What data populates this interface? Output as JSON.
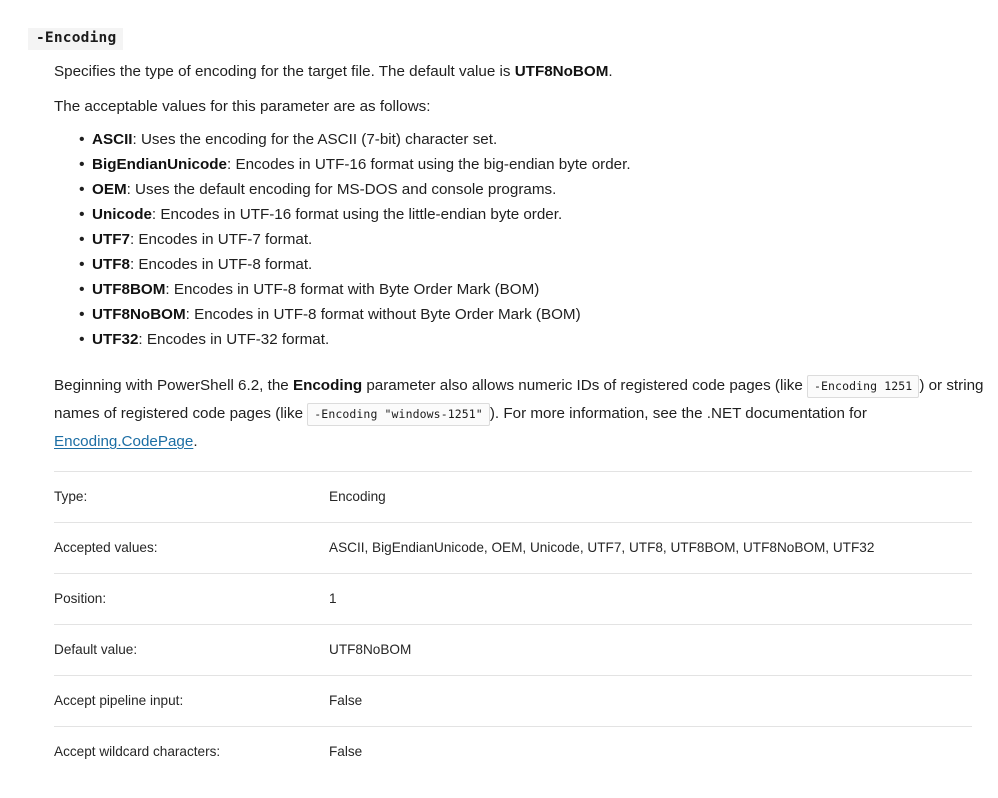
{
  "heading": {
    "text": "-Encoding"
  },
  "intro": {
    "before": "Specifies the type of encoding for the target file. The default value is ",
    "bold": "UTF8NoBOM",
    "after": "."
  },
  "acceptable_intro": "The acceptable values for this parameter are as follows:",
  "values": [
    {
      "name": "ASCII",
      "desc": ": Uses the encoding for the ASCII (7-bit) character set."
    },
    {
      "name": "BigEndianUnicode",
      "desc": ": Encodes in UTF-16 format using the big-endian byte order."
    },
    {
      "name": "OEM",
      "desc": ": Uses the default encoding for MS-DOS and console programs."
    },
    {
      "name": "Unicode",
      "desc": ": Encodes in UTF-16 format using the little-endian byte order."
    },
    {
      "name": "UTF7",
      "desc": ": Encodes in UTF-7 format."
    },
    {
      "name": "UTF8",
      "desc": ": Encodes in UTF-8 format."
    },
    {
      "name": "UTF8BOM",
      "desc": ": Encodes in UTF-8 format with Byte Order Mark (BOM)"
    },
    {
      "name": "UTF8NoBOM",
      "desc": ": Encodes in UTF-8 format without Byte Order Mark (BOM)"
    },
    {
      "name": "UTF32",
      "desc": ": Encodes in UTF-32 format."
    }
  ],
  "note": {
    "seg1": "Beginning with PowerShell 6.2, the ",
    "bold1": "Encoding",
    "seg2": " parameter also allows numeric IDs of registered code pages (like ",
    "code1": "-Encoding 1251",
    "seg3": ") or string names of registered code pages (like ",
    "code2": "-Encoding \"windows-1251\"",
    "seg4": "). For more information, see the .NET documentation for ",
    "link": "Encoding.CodePage",
    "seg5": "."
  },
  "details": {
    "rows": [
      {
        "label": "Type:",
        "value": "Encoding"
      },
      {
        "label": "Accepted values:",
        "value": "ASCII, BigEndianUnicode, OEM, Unicode, UTF7, UTF8, UTF8BOM, UTF8NoBOM, UTF32"
      },
      {
        "label": "Position:",
        "value": "1"
      },
      {
        "label": "Default value:",
        "value": "UTF8NoBOM"
      },
      {
        "label": "Accept pipeline input:",
        "value": "False"
      },
      {
        "label": "Accept wildcard characters:",
        "value": "False"
      }
    ]
  },
  "colors": {
    "page_background": "#ffffff",
    "text": "#1f1f1f",
    "heading_background": "#f4f4f4",
    "code_border": "#dcdcdc",
    "code_background": "#fbfbfb",
    "link": "#1c6ea4",
    "divider": "#e3e3e3"
  }
}
